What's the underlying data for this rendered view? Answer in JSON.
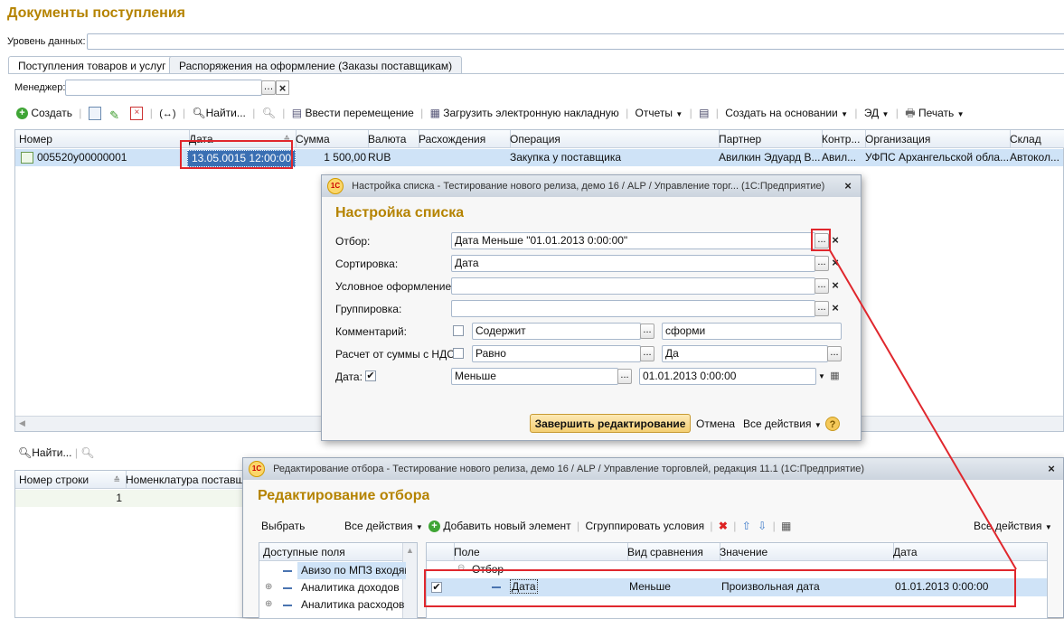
{
  "main": {
    "title": "Документы поступления",
    "level_label": "Уровень данных:",
    "tabs": [
      "Поступления товаров и услуг",
      "Распоряжения на оформление (Заказы поставщикам)"
    ],
    "manager_label": "Менеджер:",
    "toolbar": {
      "create": "Создать",
      "find": "Найти...",
      "move": "Ввести перемещение",
      "load": "Загрузить электронную накладную",
      "reports": "Отчеты",
      "create_based": "Создать на основании",
      "ed": "ЭД",
      "print": "Печать"
    },
    "columns": [
      "Номер",
      "Дата",
      "Сумма",
      "Валюта",
      "Расхождения",
      "Операция",
      "Партнер",
      "Контр...",
      "Организация",
      "Склад"
    ],
    "row": {
      "number": "005520у00000001",
      "date": "13.05.0015 12:00:00",
      "sum": "1 500,00",
      "currency": "RUB",
      "operation": "Закупка у поставщика",
      "partner": "Авилкин Эдуард В...",
      "contr": "Авил...",
      "org": "УФПС Архангельской обла...",
      "warehouse": "Автокол..."
    },
    "bottom_find": "Найти...",
    "bottom_columns": [
      "Номер строки",
      "Номенклатура поставщи"
    ],
    "bottom_row_number": "1"
  },
  "settings_dialog": {
    "window_title": "Настройка списка - Тестирование нового релиза, демо 16 / ALP / Управление торг...  (1С:Предприятие)",
    "title": "Настройка списка",
    "filter_label": "Отбор:",
    "filter_value": "Дата Меньше \"01.01.2013 0:00:00\"",
    "sort_label": "Сортировка:",
    "sort_value": "Дата",
    "cond_label": "Условное оформление:",
    "group_label": "Группировка:",
    "comment_label": "Комментарий:",
    "comment_cmp": "Содержит",
    "comment_value": "сформи",
    "vat_label": "Расчет от суммы с НДС:",
    "vat_cmp": "Равно",
    "vat_value": "Да",
    "date_label": "Дата:",
    "date_cmp": "Меньше",
    "date_value": "01.01.2013  0:00:00",
    "finish_button": "Завершить редактирование",
    "cancel": "Отмена",
    "all_actions": "Все действия",
    "help": "?",
    "dots": "...",
    "clear": "×"
  },
  "filter_dialog": {
    "window_title": "Редактирование отбора - Тестирование нового релиза, демо 16 / ALP / Управление торговлей, редакция 11.1  (1С:Предприятие)",
    "title": "Редактирование отбора",
    "choose": "Выбрать",
    "all_actions_left": "Все действия",
    "add_element": "Добавить новый элемент",
    "group_conditions": "Сгруппировать условия",
    "all_actions_right": "Все действия",
    "available_fields_header": "Доступные поля",
    "available_fields": [
      "Авизо по МПЗ входящ",
      "Аналитика доходов",
      "Аналитика расходов"
    ],
    "columns": [
      "Поле",
      "Вид сравнения",
      "Значение",
      "Дата"
    ],
    "group_row": "Отбор",
    "row": {
      "field": "Дата",
      "cmp": "Меньше",
      "value": "Произвольная дата",
      "date": "01.01.2013 0:00:00"
    }
  },
  "colors": {
    "accent_title": "#b58300",
    "highlight_red": "#e0272d",
    "selection": "#cfe3f7"
  }
}
